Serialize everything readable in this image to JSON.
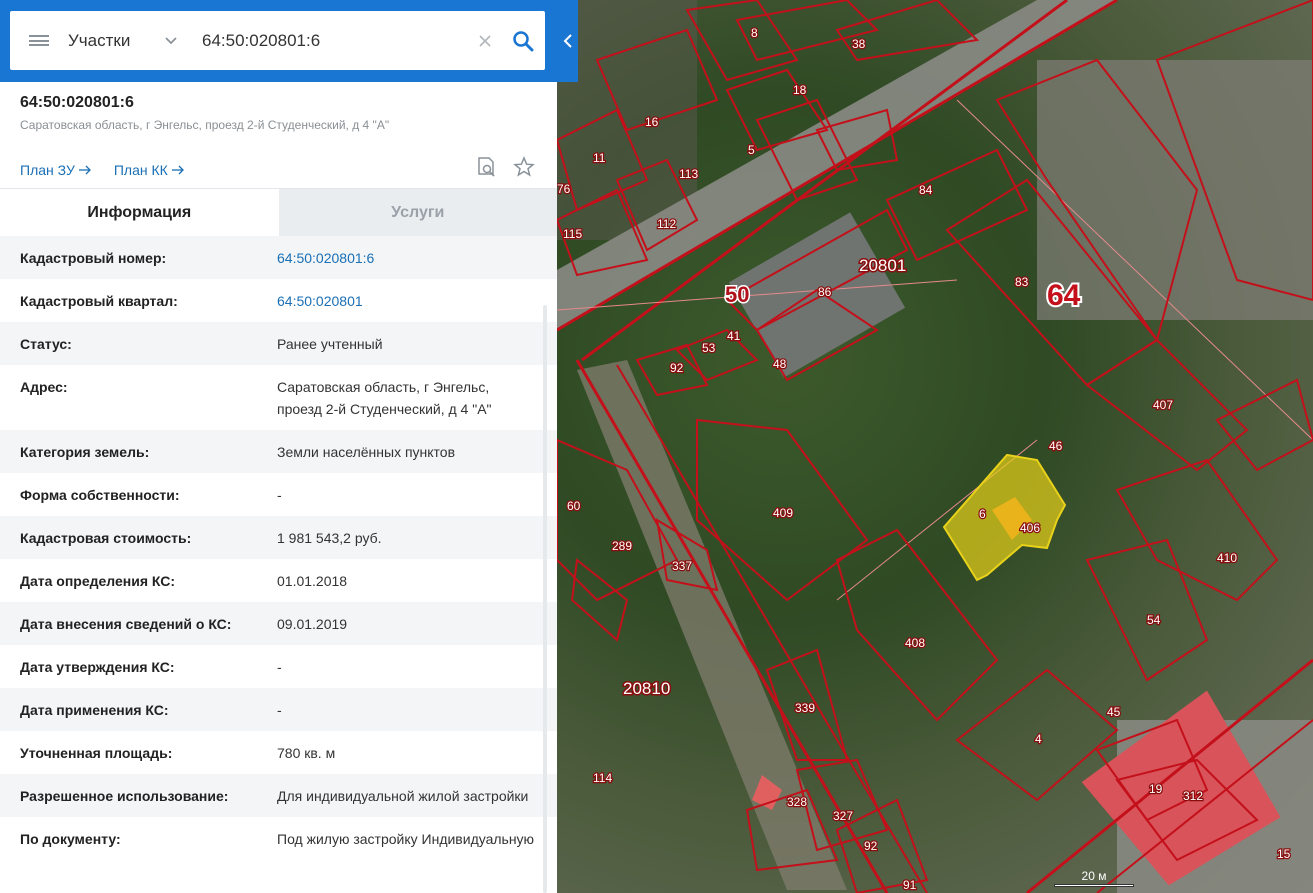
{
  "search": {
    "category": "Участки",
    "query": "64:50:020801:6",
    "icons": {
      "menu": "hamburger-menu-icon",
      "dropdown": "chevron-down-icon",
      "clear": "close-icon",
      "search": "search-icon",
      "collapse": "chevron-left-icon"
    }
  },
  "object": {
    "number": "64:50:020801:6",
    "address": "Саратовская область, г Энгельс, проезд 2-й Студенческий, д 4 \"А\"",
    "plan_zu": "План ЗУ",
    "plan_kk": "План КК",
    "icons": {
      "plan_arrow": "arrow-right-icon",
      "search_doc": "document-search-icon",
      "favorite": "star-icon"
    }
  },
  "tabs": [
    {
      "label": "Информация",
      "active": true
    },
    {
      "label": "Услуги",
      "active": false
    }
  ],
  "info": [
    {
      "key": "Кадастровый номер:",
      "value": "64:50:020801:6",
      "link": true
    },
    {
      "key": "Кадастровый квартал:",
      "value": "64:50:020801",
      "link": true
    },
    {
      "key": "Статус:",
      "value": "Ранее учтенный"
    },
    {
      "key": "Адрес:",
      "value": "Саратовская область, г Энгельс, проезд 2-й Студенческий, д 4 \"А\""
    },
    {
      "key": "Категория земель:",
      "value": "Земли населённых пунктов"
    },
    {
      "key": "Форма собственности:",
      "value": "-"
    },
    {
      "key": "Кадастровая стоимость:",
      "value": "1 981 543,2 руб."
    },
    {
      "key": "Дата определения КС:",
      "value": "01.01.2018"
    },
    {
      "key": "Дата внесения сведений о КС:",
      "value": "09.01.2019"
    },
    {
      "key": "Дата утверждения КС:",
      "value": "-"
    },
    {
      "key": "Дата применения КС:",
      "value": "-"
    },
    {
      "key": "Уточненная площадь:",
      "value": "780 кв. м"
    },
    {
      "key": "Разрешенное использование:",
      "value": "Для индивидуальной жилой застройки"
    },
    {
      "key": "По документу:",
      "value": "Под жилую застройку Индивидуальную"
    }
  ],
  "map": {
    "quarter_labels": [
      "20801",
      "20810",
      "50",
      "64"
    ],
    "parcel_labels": [
      "8",
      "38",
      "18",
      "16",
      "11",
      "5",
      "113",
      "76",
      "112",
      "115",
      "84",
      "86",
      "83",
      "41",
      "53",
      "92",
      "48",
      "407",
      "46",
      "409",
      "6",
      "406",
      "60",
      "289",
      "337",
      "410",
      "408",
      "54",
      "45",
      "339",
      "4",
      "114",
      "328",
      "327",
      "19",
      "312",
      "92",
      "91",
      "15"
    ],
    "scale": "20 м",
    "colors": {
      "boundary": "#c4101a",
      "selected_fill": "#e8d21a",
      "panel_accent": "#1976d2"
    }
  }
}
